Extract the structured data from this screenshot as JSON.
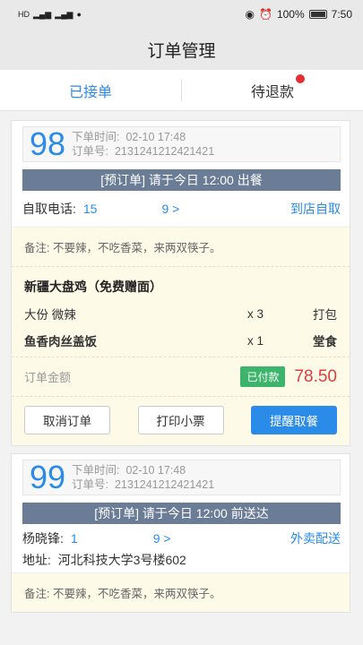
{
  "status_bar": {
    "left_icons": [
      "HD",
      "5G",
      "4G",
      "message-icon"
    ],
    "battery": "100%",
    "time": "7:50"
  },
  "title": "订单管理",
  "tabs": [
    {
      "label": "已接单",
      "active": true
    },
    {
      "label": "待退款",
      "active": false,
      "has_dot": true
    }
  ],
  "orders": [
    {
      "number": "98",
      "time_label": "下单时间:",
      "time_value": "02-10  17:48",
      "id_label": "订单号:",
      "id_value": "2131241212421421",
      "banner": "[预订单] 请于今日 12:00 出餐",
      "phone_label": "自取电话:",
      "phone_start": "15",
      "phone_end": "9 >",
      "mode": "到店自取",
      "note": "备注:  不要辣，不吃香菜，来两双筷子。",
      "dish_title": "新疆大盘鸡（免费赠面）",
      "items": [
        {
          "name": "大份  微辣",
          "qty": "x 3",
          "tag": "打包"
        },
        {
          "name": "鱼香肉丝盖饭",
          "qty": "x 1",
          "tag": "堂食"
        }
      ],
      "amount_label": "订单金额",
      "paid_label": "已付款",
      "amount": "78.50",
      "buttons": {
        "cancel": "取消订单",
        "print": "打印小票",
        "remind": "提醒取餐"
      }
    },
    {
      "number": "99",
      "time_label": "下单时间:",
      "time_value": "02-10  17:48",
      "id_label": "订单号:",
      "id_value": "2131241212421421",
      "banner": "[预订单] 请于今日 12:00 前送达",
      "customer_name": "杨晓锋:",
      "phone_start": "1",
      "phone_end": "9 >",
      "mode": "外卖配送",
      "address_label": "地址:",
      "address": "河北科技大学3号楼602",
      "note": "备注:  不要辣，不吃香菜，来两双筷子。"
    }
  ],
  "colors": {
    "accent": "#2a8be8",
    "banner": "#6a7c96",
    "paid": "#3cb46c",
    "price": "#e03d3d",
    "detail_bg": "#fdfbe8"
  }
}
